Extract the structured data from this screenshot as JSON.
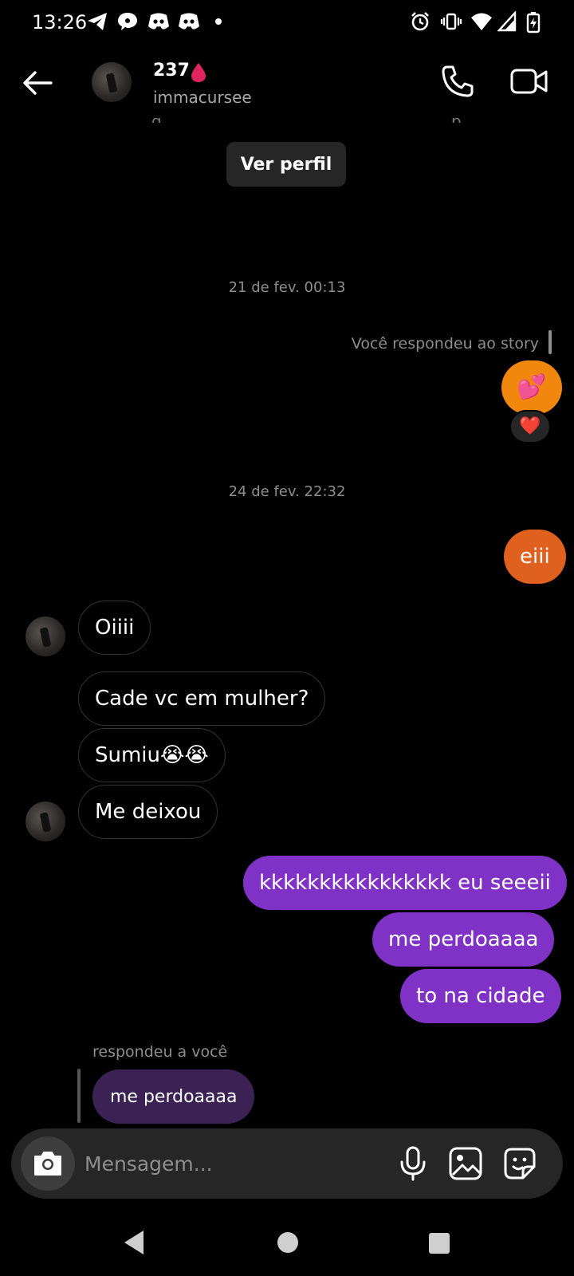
{
  "status_bar": {
    "time": "13:26",
    "left_icons": [
      "telegram-icon",
      "chat-bubble-icon",
      "discord-icon",
      "discord-icon",
      "dot-icon"
    ],
    "right_icons": [
      "alarm-icon",
      "vibrate-icon",
      "wifi-icon",
      "signal-icon",
      "battery-charging-icon"
    ]
  },
  "header": {
    "name": "237",
    "username": "immacursee",
    "accent_color": "#e0245e"
  },
  "conversation": {
    "view_profile_label": "Ver perfil",
    "date_1": "21 de fev. 00:13",
    "story_reply_label": "Você respondeu ao story",
    "story_emoji": "💕",
    "story_reaction": "❤️",
    "date_2": "24 de fev. 22:32",
    "messages": [
      {
        "from": "me",
        "text": "eiii"
      },
      {
        "from": "them",
        "text": "Oiiii"
      },
      {
        "from": "them",
        "text": "Cade vc em mulher?"
      },
      {
        "from": "them",
        "text": "Sumiu😭😭"
      },
      {
        "from": "them",
        "text": "Me deixou"
      },
      {
        "from": "me",
        "text": "kkkkkkkkkkkkkkkk eu seeeii"
      },
      {
        "from": "me",
        "text": "me perdoaaaa"
      },
      {
        "from": "me",
        "text": "to na cidade"
      }
    ],
    "reply": {
      "label": "respondeu a você",
      "quoted_text": "me perdoaaaa"
    }
  },
  "composer": {
    "placeholder": "Mensagem..."
  },
  "colors": {
    "background": "#000000",
    "outgoing_orange": "#e0611f",
    "outgoing_purple": "#8132c6",
    "story_orange": "#f2870d",
    "reply_bubble": "#3c2155",
    "secondary_text": "#8e8e8e"
  }
}
